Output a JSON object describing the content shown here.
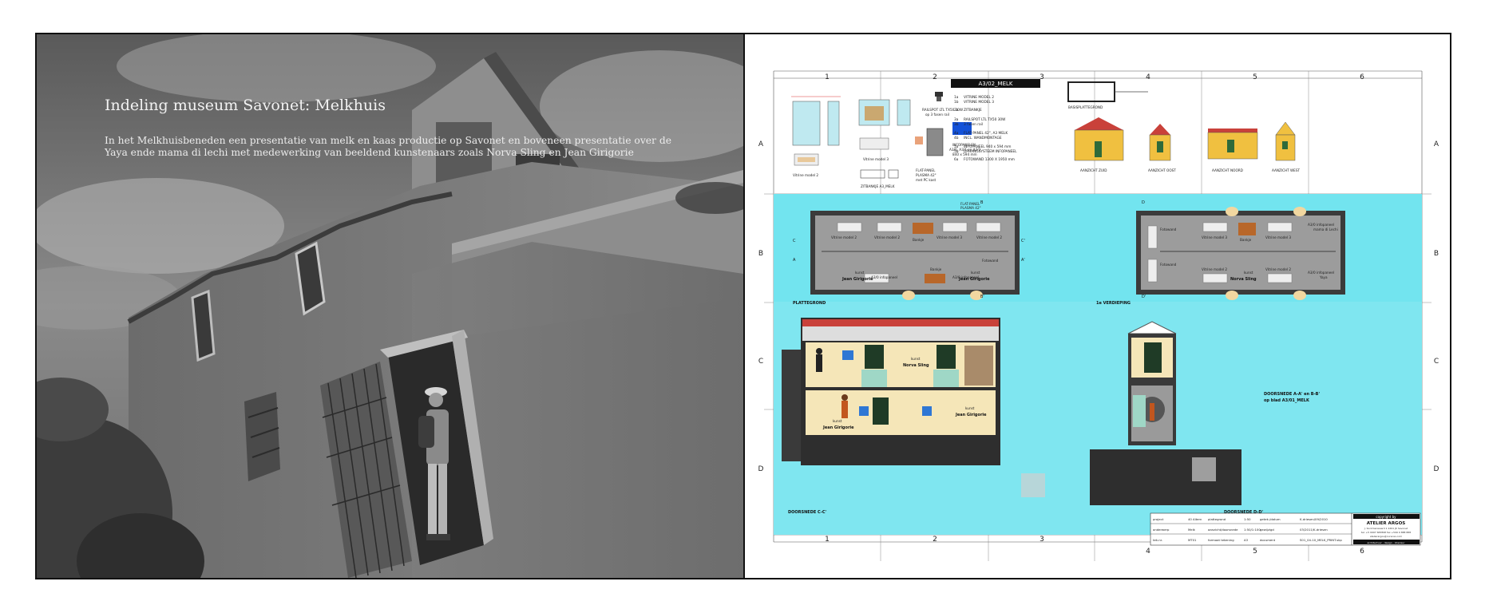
{
  "left_page": {
    "title": "Indeling museum Savonet: Melkhuis",
    "body": "In het Melkhuisbeneden een presentatie van melk en kaas productie op Savonet en boveneen presentatie over de Yaya ende mama di lechi met medewerking van beeldend kunstenaars zoals Norva Sling en Jean Girigorie"
  },
  "drawing": {
    "columns": [
      "1",
      "2",
      "3",
      "4",
      "5",
      "6"
    ],
    "rows": [
      "A",
      "B",
      "C",
      "D"
    ],
    "sheet_code": "A3/02_MELK",
    "legend": [
      {
        "num": "1a",
        "text": "VITRINE MODEL 2"
      },
      {
        "num": "1b",
        "text": "VITRINE MODEL 3"
      },
      {
        "num": "2a",
        "text": "ZITBANKJE"
      },
      {
        "num": "3a",
        "text": "RAILSPOT LTL TX50 30W"
      },
      {
        "num": "3b",
        "text": "3 fasen rail"
      },
      {
        "num": "4a",
        "text": "FLAT-PANEL 42\", A3 MELK"
      },
      {
        "num": "4b",
        "text": "INCL. WANDMONTAGE"
      },
      {
        "num": "5a",
        "text": "INFOPANEEL 940 x 594 mm"
      },
      {
        "num": "5b",
        "text": "OPHANGSYSTEEM INFOPANEEL"
      },
      {
        "num": "6a",
        "text": "FOTOWAND 1300 X 1950 mm"
      }
    ],
    "section_labels": {
      "plattegrond": "PLATTEGROND",
      "verdieping": "1e VERDIEPING",
      "doorsnede_cc": "DOORSNEDE C-C'",
      "doorsnede_dd": "DOORSNEDE D-D'",
      "doorsnede_ref_1": "DOORSNEDE A-A' en B-B'",
      "doorsnede_ref_2": "op blad A3/01_MELK"
    },
    "elevations": [
      "AANZICHT ZUID",
      "AANZICHT OOST",
      "AANZICHT NOORD",
      "AANZICHT WEST"
    ],
    "situatie": "BASISPLATTEGROND",
    "details": {
      "vitrine_model_2": "Vitrine model 2",
      "vitrine_model_3": "Vitrine model 3",
      "zitbankje": "ZITBANKJE A3_MELK",
      "railspot": "RAILSPOT LTL TX50 30W",
      "railspot_sub": "op 3 fasen rail",
      "flat_panel": "FLAT-PANEL",
      "flat_panel_sub": "PLASMA 42\"",
      "flat_panel_sub2": "met PC kast",
      "infopanelen": "INFOPANELEN",
      "infopanelen_sub": "A3/0, A3/1 en A3/2",
      "infopanelen_sub2": "840 x 594 mm"
    },
    "plan_labels": {
      "vitrine2": "Vitrine model 2",
      "vitrine3": "Vitrine model 3",
      "bankje": "Bankje",
      "fotowand": "Fotowand",
      "infopaneel": "A3/0 infopaneel",
      "kunst": "kunst",
      "jean": "Jean Girigorie",
      "norva": "Norva Sling",
      "mama": "mama di Lechi",
      "yaya": "Yaya",
      "flat_panel_1": "FLAT-PANEL",
      "flat_panel_2": "PLASMA 42\""
    },
    "section_marks": [
      "A",
      "A'",
      "B",
      "B'",
      "C",
      "C'",
      "D",
      "D'"
    ],
    "titleblock": {
      "rows": [
        [
          "project",
          "40 Altern",
          "plattegrond",
          "1:50",
          "getek./datum",
          "K.driesen/09/2010"
        ],
        [
          "onderwerp",
          "Melk",
          "aanzicht/doorsnede",
          "1:50/1:100",
          "gewijzigd",
          "03/2011/K.driesen"
        ],
        [
          "tek.nr.",
          "MT01",
          "formaat tekening",
          "A3",
          "document",
          "S01_04-10_MELK_PRINT.skp"
        ]
      ],
      "copyright": "copyright by",
      "firm": "ATELIER ARGOS",
      "firm_lines": [
        "J. Sockmenwaard 1  2491 JK Savonet",
        "tel. +5 9997 683898  fax +599 9 888 888",
        "atelierargos@curacao.com"
      ],
      "firm_footer": "architectuur  -  design  -  interieur"
    }
  }
}
